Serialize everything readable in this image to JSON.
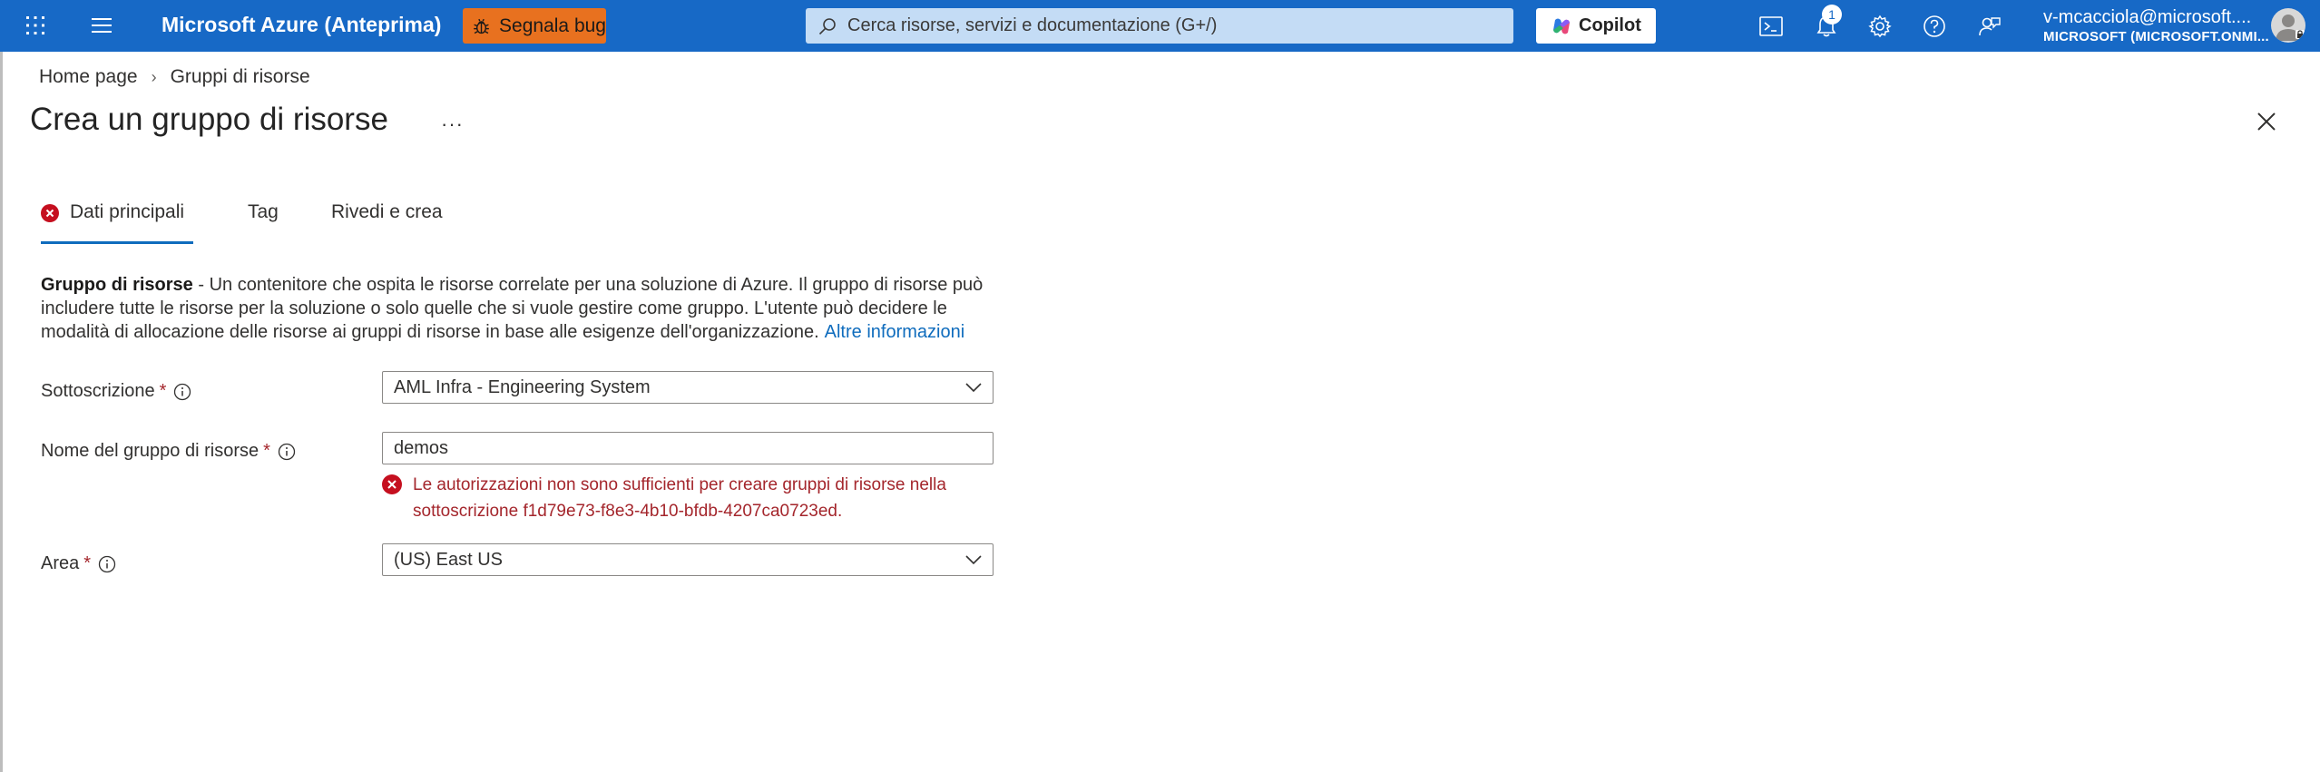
{
  "topbar": {
    "brand": "Microsoft Azure (Anteprima)",
    "bug_button_label": "Segnala bug",
    "search_placeholder": "Cerca risorse, servizi e documentazione (G+/)",
    "copilot_label": "Copilot",
    "notification_count": "1",
    "account_email": "v-mcacciola@microsoft....",
    "account_tenant": "MICROSOFT (MICROSOFT.ONMI..."
  },
  "breadcrumb": {
    "items": [
      "Home page",
      "Gruppi di risorse"
    ]
  },
  "page": {
    "title": "Crea un gruppo di risorse",
    "more_label": "···"
  },
  "tabs": [
    {
      "label": "Dati principali",
      "active": true,
      "has_error": true
    },
    {
      "label": "Tag",
      "active": false
    },
    {
      "label": "Rivedi e crea",
      "active": false
    }
  ],
  "description": {
    "bold": "Gruppo di risorse",
    "text": " - Un contenitore che ospita le risorse correlate per una soluzione di Azure. Il gruppo di risorse può includere tutte le risorse per la soluzione o solo quelle che si vuole gestire come gruppo. L'utente può decidere le modalità di allocazione delle risorse ai gruppi di risorse in base alle esigenze dell'organizzazione.",
    "link": "Altre informazioni"
  },
  "form": {
    "subscription": {
      "label": "Sottoscrizione",
      "required_mark": "*",
      "value": "AML Infra - Engineering System"
    },
    "resource_group": {
      "label": "Nome del gruppo di risorse",
      "required_mark": "*",
      "value": "demos",
      "error": "Le autorizzazioni non sono sufficienti per creare gruppi di risorse nella sottoscrizione f1d79e73-f8e3-4b10-bfdb-4207ca0723ed."
    },
    "region": {
      "label": "Area",
      "required_mark": "*",
      "value": "(US) East US"
    }
  },
  "colors": {
    "topbar": "#1769c6",
    "bug_button": "#e8711f",
    "search_bg": "#c4dcf5",
    "link": "#0f6cbd",
    "error": "#a4262c",
    "error_icon": "#c50f1f"
  },
  "icons": [
    "waffle-icon",
    "hamburger-icon",
    "bug-icon",
    "search-icon",
    "copilot-icon",
    "cloud-shell-icon",
    "bell-icon",
    "gear-icon",
    "help-icon",
    "feedback-icon",
    "close-icon",
    "error-icon",
    "info-icon",
    "chevron-down-icon"
  ]
}
